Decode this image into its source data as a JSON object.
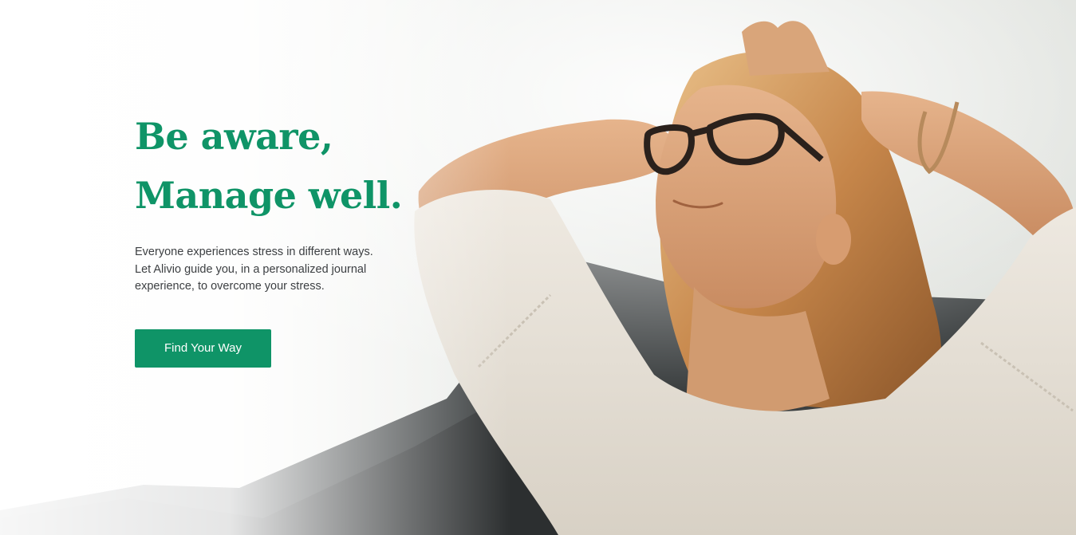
{
  "hero": {
    "headline_line1": "Be aware,",
    "headline_line2": "Manage well.",
    "intro_line1": "Everyone experiences stress in different ways.",
    "intro_line2": "Let Alivio guide you, in a personalized journal",
    "intro_line3": "experience, to overcome your stress.",
    "cta_label": "Find Your Way"
  },
  "colors": {
    "accent": "#0f9467",
    "body_text": "#3c3f42",
    "button_text": "#ffffff"
  }
}
